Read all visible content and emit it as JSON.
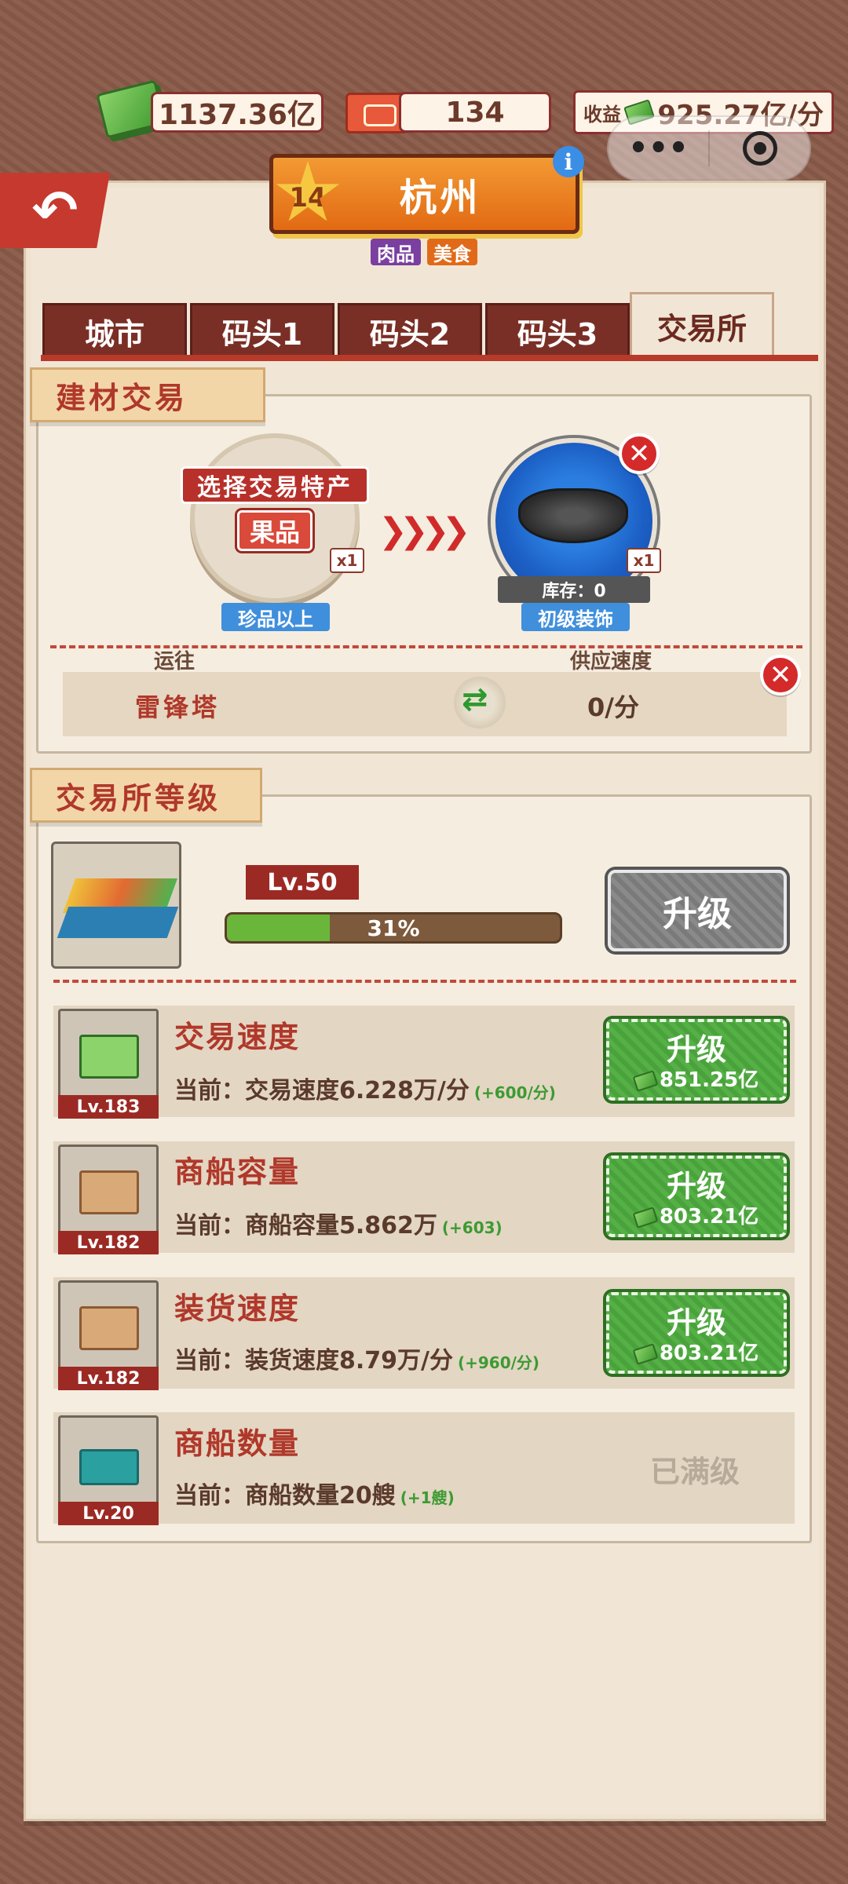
{
  "currency": {
    "cash": "1137.36亿",
    "tickets": "134"
  },
  "income": {
    "label": "收益",
    "value": "925.27亿/分"
  },
  "city": {
    "level": "14",
    "name": "杭州",
    "tags": [
      "肉品",
      "美食"
    ]
  },
  "tabs": [
    "城市",
    "码头1",
    "码头2",
    "码头3",
    "交易所"
  ],
  "trade": {
    "section_title": "建材交易",
    "select_label": "选择交易特产",
    "selected_item": "果品",
    "from_qty": "x1",
    "from_quality": "珍品以上",
    "to_qty": "x1",
    "to_stock": "库存：0",
    "to_item": "初级装饰",
    "dest_header": "运往",
    "speed_header": "供应速度",
    "destination": "雷锋塔",
    "speed": "0/分"
  },
  "exchange": {
    "section_title": "交易所等级",
    "level": "Lv.50",
    "progress_text": "31%",
    "progress": 0.31,
    "upgrade_label": "升级"
  },
  "upgrades": [
    {
      "level": "Lv.183",
      "title": "交易速度",
      "desc": "当前：交易速度6.228万/分",
      "inc": "(+600/分)",
      "btn": "升级",
      "cost": "851.25亿"
    },
    {
      "level": "Lv.182",
      "title": "商船容量",
      "desc": "当前：商船容量5.862万",
      "inc": "(+603)",
      "btn": "升级",
      "cost": "803.21亿"
    },
    {
      "level": "Lv.182",
      "title": "装货速度",
      "desc": "当前：装货速度8.79万/分",
      "inc": "(+960/分)",
      "btn": "升级",
      "cost": "803.21亿"
    },
    {
      "level": "Lv.20",
      "title": "商船数量",
      "desc": "当前：商船数量20艘",
      "inc": "(+1艘)",
      "maxed": "已满级"
    }
  ]
}
